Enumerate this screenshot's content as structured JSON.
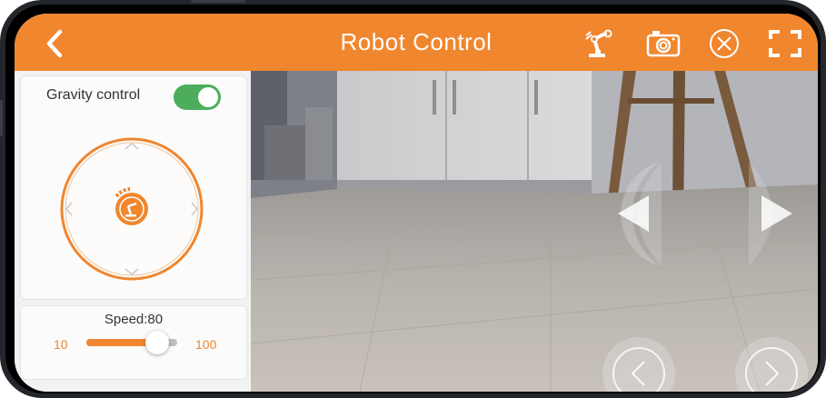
{
  "header": {
    "title": "Robot Control",
    "back_icon": "chevron-left-icon",
    "robot_arm_icon": "robot-arm-icon",
    "camera_icon": "camera-icon",
    "close_icon": "close-circle-icon",
    "fullscreen_icon": "fullscreen-icon",
    "accent_color": "#f0862e"
  },
  "gravity": {
    "label": "Gravity control",
    "enabled": true,
    "toggle_color": "#4cae5d"
  },
  "joystick": {
    "up_icon": "chevron-up-icon",
    "down_icon": "chevron-down-icon",
    "left_icon": "chevron-left-icon",
    "right_icon": "chevron-right-icon",
    "center_icon": "robot-arm-icon"
  },
  "speed": {
    "label": "Speed:80",
    "min_label": "10",
    "max_label": "100",
    "value": 80,
    "min": 10,
    "max": 100
  },
  "camera_overlay": {
    "left_arrow_icon": "triangle-left-icon",
    "right_arrow_icon": "triangle-right-icon",
    "prev_icon": "chevron-left-circle-icon",
    "next_icon": "chevron-right-circle-icon"
  }
}
